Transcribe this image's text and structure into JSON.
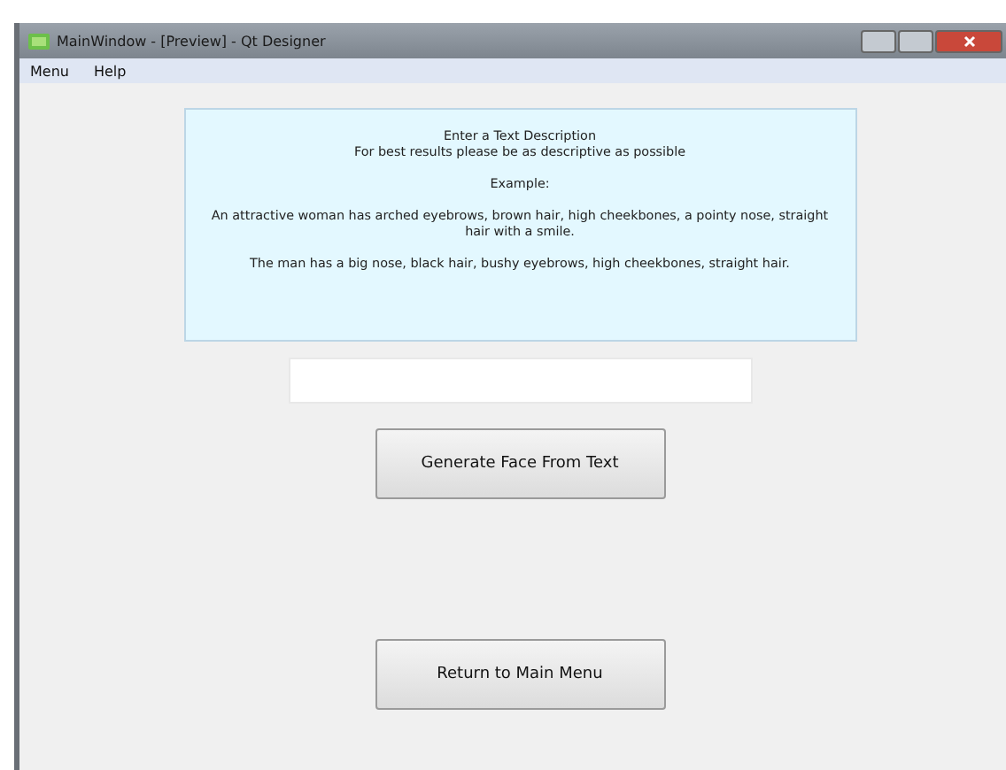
{
  "window": {
    "title": "MainWindow - [Preview] - Qt Designer"
  },
  "menu_bar": [
    "Menu",
    "Help"
  ],
  "description_panel": {
    "heading": "Enter a Text Description",
    "subheading": "For best results please be as descriptive as possible",
    "example_label": "Example:",
    "examples": [
      "An attractive woman has arched eyebrows, brown hair, high cheekbones, a pointy nose, straight hair with a smile.",
      "The man has a big nose, black hair, bushy eyebrows, high cheekbones, straight hair."
    ]
  },
  "buttons": [
    "Generate Face From Text",
    "Return to Main Menu"
  ]
}
